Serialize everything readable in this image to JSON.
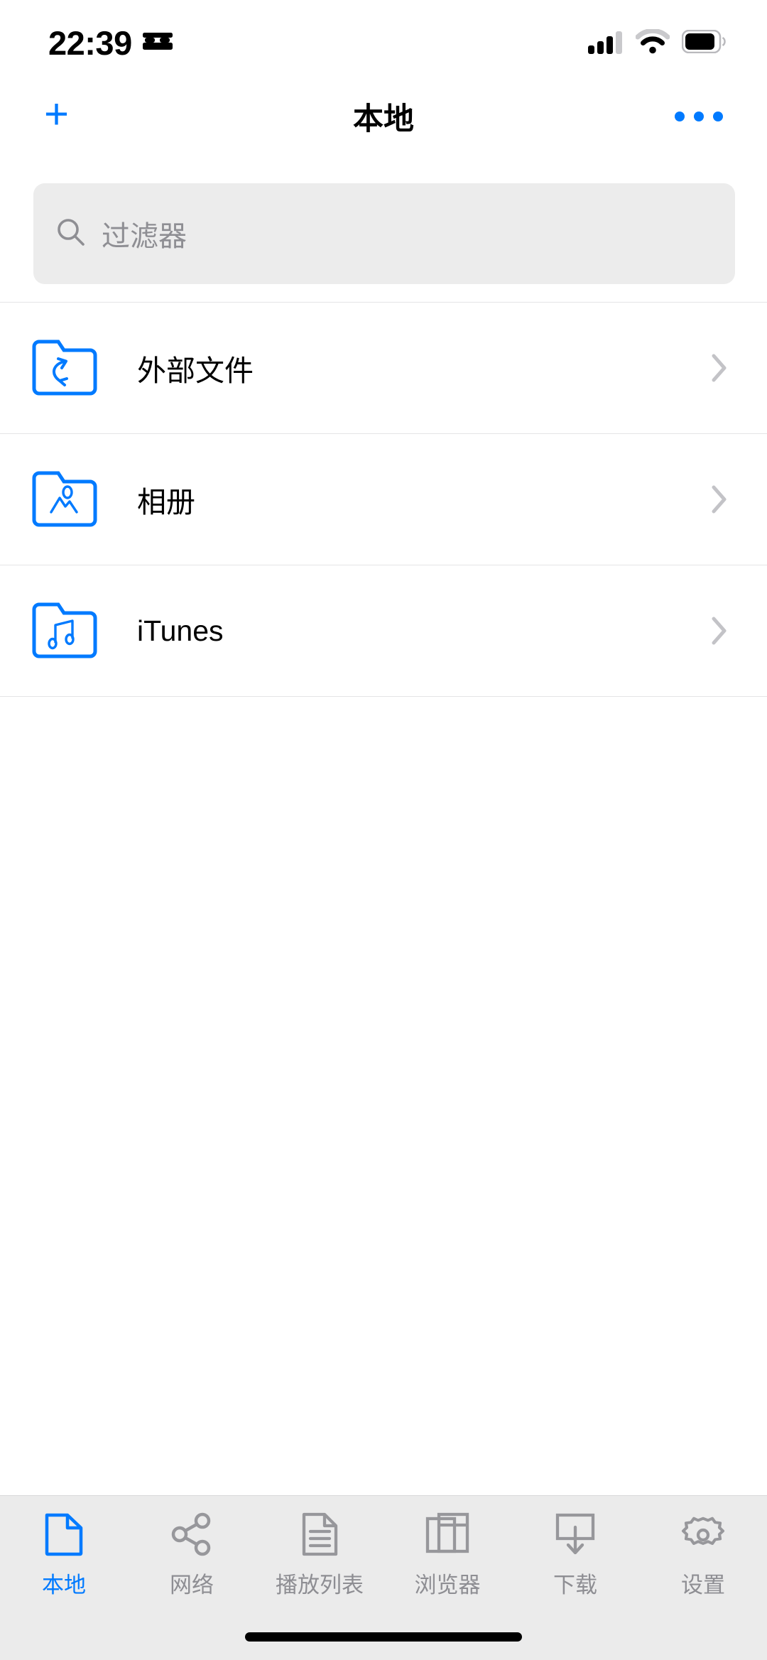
{
  "theme": {
    "accent": "#007aff",
    "inactive_gray": "#8e8e93",
    "search_bg": "#ececec",
    "tabbar_bg": "#ebebeb",
    "separator": "#e4e4e6",
    "background": "#ffffff"
  },
  "status_bar": {
    "time": "22:39",
    "sleep_focus_icon": "bed-icon",
    "cellular_icon": "signal-bars-icon",
    "cellular_bars_filled": 3,
    "cellular_bars_total": 4,
    "wifi_icon": "wifi-icon",
    "battery_icon": "battery-icon",
    "battery_level_percent": 85
  },
  "nav_bar": {
    "add_label": "+",
    "add_icon": "plus-icon",
    "title": "本地",
    "more_icon": "more-horizontal-icon"
  },
  "search": {
    "placeholder": "过滤器",
    "value": "",
    "icon": "search-icon"
  },
  "list": {
    "rows": [
      {
        "label": "外部文件",
        "icon": "folder-external-link-icon",
        "chevron": "chevron-right-icon"
      },
      {
        "label": "相册",
        "icon": "folder-photos-icon",
        "chevron": "chevron-right-icon"
      },
      {
        "label": "iTunes",
        "icon": "folder-music-icon",
        "chevron": "chevron-right-icon"
      }
    ]
  },
  "tab_bar": {
    "active_index": 0,
    "items": [
      {
        "label": "本地",
        "icon": "document-icon"
      },
      {
        "label": "网络",
        "icon": "share-network-icon"
      },
      {
        "label": "播放列表",
        "icon": "playlist-icon"
      },
      {
        "label": "浏览器",
        "icon": "browser-windows-icon"
      },
      {
        "label": "下载",
        "icon": "download-icon"
      },
      {
        "label": "设置",
        "icon": "gear-icon"
      }
    ]
  },
  "home_indicator": {
    "icon": "home-indicator-bar"
  }
}
